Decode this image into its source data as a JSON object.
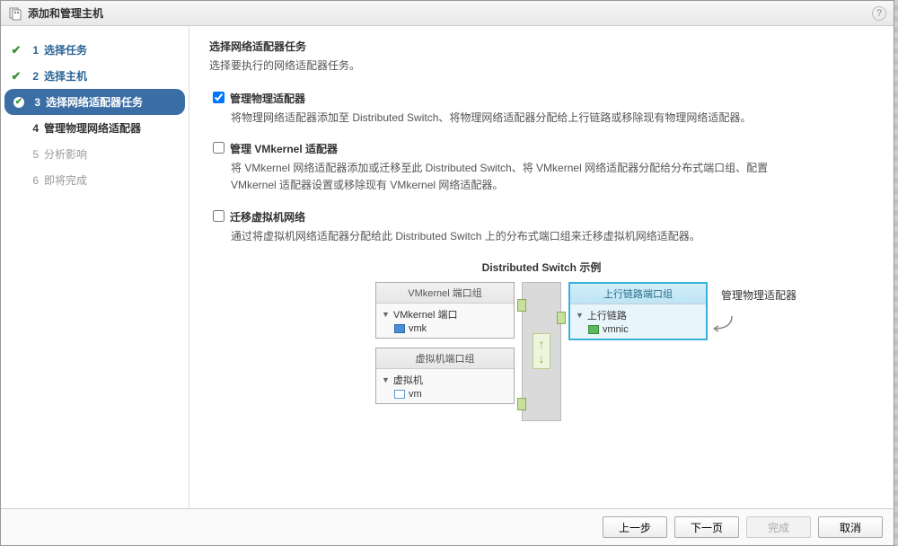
{
  "title": "添加和管理主机",
  "steps": [
    {
      "num": "1",
      "label": "选择任务",
      "state": "done"
    },
    {
      "num": "2",
      "label": "选择主机",
      "state": "done"
    },
    {
      "num": "3",
      "label": "选择网络适配器任务",
      "state": "current"
    },
    {
      "num": "4",
      "label": "管理物理网络适配器",
      "state": "future"
    },
    {
      "num": "5",
      "label": "分析影响",
      "state": "disabled"
    },
    {
      "num": "6",
      "label": "即将完成",
      "state": "disabled"
    }
  ],
  "content": {
    "heading": "选择网络适配器任务",
    "subtitle": "选择要执行的网络适配器任务。",
    "options": [
      {
        "id": "manage-physical",
        "checked": true,
        "label": "管理物理适配器",
        "desc": "将物理网络适配器添加至 Distributed Switch、将物理网络适配器分配给上行链路或移除现有物理网络适配器。"
      },
      {
        "id": "manage-vmkernel",
        "checked": false,
        "label": "管理 VMkernel 适配器",
        "desc": "将 VMkernel 网络适配器添加或迁移至此 Distributed Switch、将 VMkernel 网络适配器分配给分布式端口组、配置 VMkernel 适配器设置或移除现有 VMkernel 网络适配器。"
      },
      {
        "id": "migrate-vm",
        "checked": false,
        "label": "迁移虚拟机网络",
        "desc": "通过将虚拟机网络适配器分配给此 Distributed Switch 上的分布式端口组来迁移虚拟机网络适配器。"
      }
    ]
  },
  "diagram": {
    "title": "Distributed Switch 示例",
    "vmkernel_pg": "VMkernel 端口组",
    "vmkernel_port": "VMkernel 端口",
    "vmk": "vmk",
    "vm_pg": "虚拟机端口组",
    "vm_label": "虚拟机",
    "vm": "vm",
    "uplink_pg": "上行链路端口组",
    "uplink": "上行链路",
    "vmnic": "vmnic",
    "callout": "管理物理适配器"
  },
  "buttons": {
    "back": "上一步",
    "next": "下一页",
    "finish": "完成",
    "cancel": "取消"
  }
}
